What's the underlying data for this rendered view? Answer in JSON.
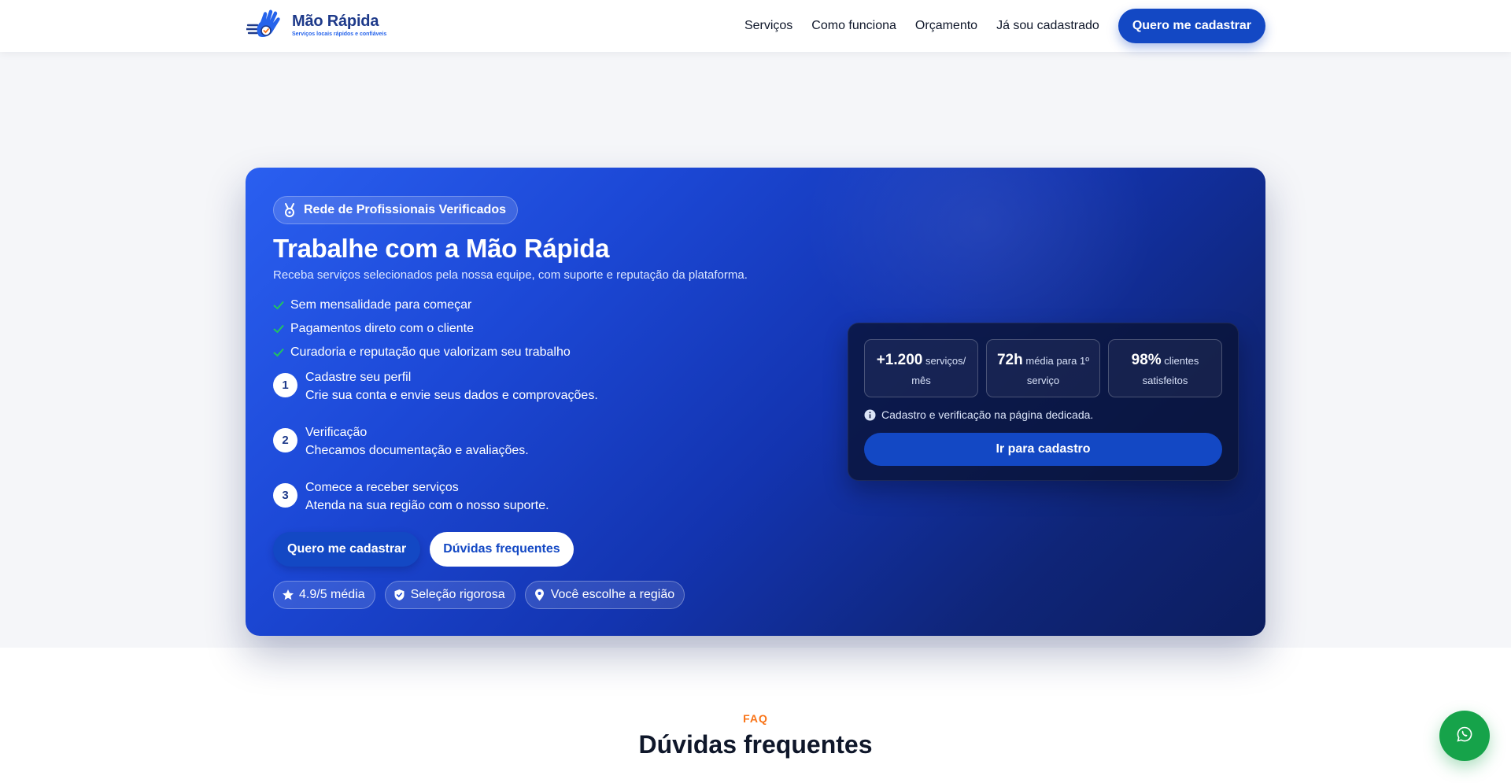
{
  "header": {
    "brand_name": "Mão Rápida",
    "brand_tagline": "Serviços locais rápidos e confiáveis",
    "nav": [
      {
        "label": "Serviços"
      },
      {
        "label": "Como funciona"
      },
      {
        "label": "Orçamento"
      },
      {
        "label": "Já sou cadastrado"
      }
    ],
    "cta_label": "Quero me cadastrar"
  },
  "hero": {
    "badge_label": "Rede de Profissionais Verificados",
    "badge_icon": "medal-icon",
    "title": "Trabalhe com a Mão Rápida",
    "subtitle": "Receba serviços selecionados pela nossa equipe, com suporte e reputação da plataforma.",
    "checks": [
      {
        "label": "Sem mensalidade para começar"
      },
      {
        "label": "Pagamentos direto com o cliente"
      },
      {
        "label": "Curadoria e reputação que valorizam seu trabalho"
      }
    ],
    "steps": [
      {
        "number": "1",
        "title": "Cadastre seu perfil",
        "desc": "Crie sua conta e envie seus dados e comprovações."
      },
      {
        "number": "2",
        "title": "Verificação",
        "desc": "Checamos documentação e avaliações."
      },
      {
        "number": "3",
        "title": "Comece a receber serviços",
        "desc": "Atenda na sua região com o nosso suporte."
      }
    ],
    "primary_cta": "Quero me cadastrar",
    "secondary_cta": "Dúvidas frequentes",
    "chips": [
      {
        "label": "4.9/5 média",
        "icon": "star-icon"
      },
      {
        "label": "Seleção rigorosa",
        "icon": "shield-check-icon"
      },
      {
        "label": "Você escolhe a região",
        "icon": "map-pin-icon"
      }
    ]
  },
  "stats_panel": {
    "stats": [
      {
        "value": "+1.200",
        "label": "serviços/",
        "label2": "mês"
      },
      {
        "value": "72h",
        "label": "média para 1º",
        "label2": "serviço"
      },
      {
        "value": "98%",
        "label": "clientes",
        "label2": "satisfeitos"
      }
    ],
    "note": "Cadastro e verificação na página dedicada.",
    "cta_label": "Ir para cadastro"
  },
  "faq": {
    "kicker": "FAQ",
    "title": "Dúvidas frequentes"
  },
  "floating": {
    "whatsapp_icon": "whatsapp-icon"
  },
  "colors": {
    "primary": "#1348c4",
    "hero_gradient_start": "#2a5ff0",
    "hero_gradient_end": "#0c1d5e",
    "check_green": "#22c55e",
    "accent_orange": "#f97316",
    "whatsapp_green": "#16a34a"
  }
}
